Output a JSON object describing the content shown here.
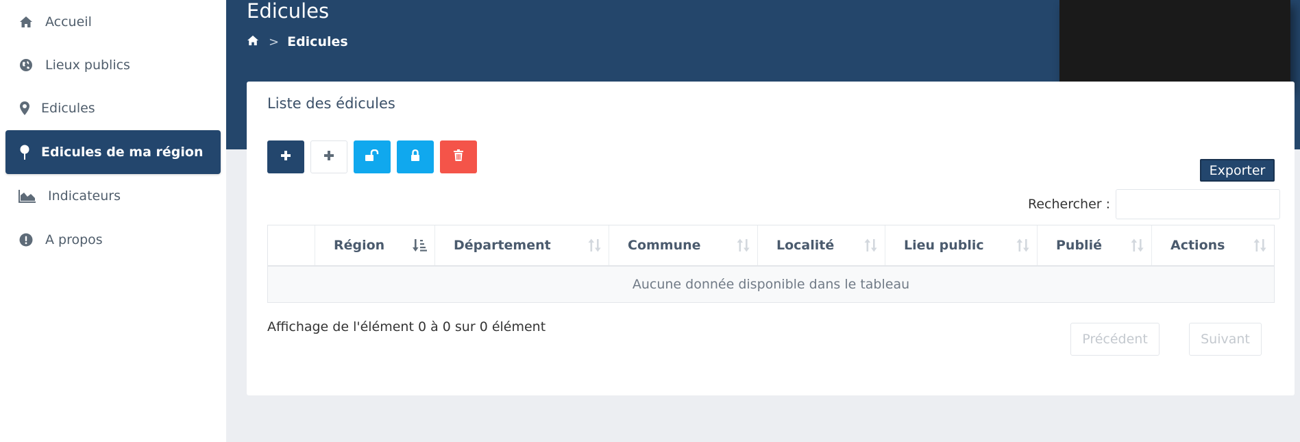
{
  "sidebar": {
    "items": [
      {
        "label": "Accueil",
        "icon": "home-icon",
        "active": false
      },
      {
        "label": "Lieux publics",
        "icon": "globe-icon",
        "active": false
      },
      {
        "label": "Edicules",
        "icon": "map-marker-icon",
        "active": false
      },
      {
        "label": "Edicules de ma région",
        "icon": "map-pin-icon",
        "active": true
      },
      {
        "label": "Indicateurs",
        "icon": "area-chart-icon",
        "active": false
      },
      {
        "label": "A propos",
        "icon": "exclamation-circle-icon",
        "active": false
      }
    ]
  },
  "header": {
    "title": "Edicules",
    "breadcrumb": {
      "home_icon": "home-icon",
      "separator": ">",
      "current": "Edicules"
    }
  },
  "card": {
    "title": "Liste des édicules",
    "toolbar": {
      "add_primary_icon": "plus-icon",
      "add_secondary_icon": "plus-icon",
      "unlock_icon": "unlock-icon",
      "lock_icon": "lock-icon",
      "delete_icon": "trash-icon"
    },
    "export_label": "Exporter",
    "search": {
      "label": "Rechercher :",
      "value": "",
      "placeholder": ""
    },
    "table": {
      "columns": [
        "",
        "Région",
        "Département",
        "Commune",
        "Localité",
        "Lieu public",
        "Publié",
        "Actions"
      ],
      "empty_message": "Aucune donnée disponible dans le tableau"
    },
    "info": "Affichage de l'élément 0 à 0 sur 0 élément",
    "pagination": {
      "previous": "Précédent",
      "next": "Suivant"
    }
  },
  "colors": {
    "primary": "#23466d",
    "info": "#10a8ee",
    "danger": "#f45449",
    "background": "#eceef2"
  }
}
